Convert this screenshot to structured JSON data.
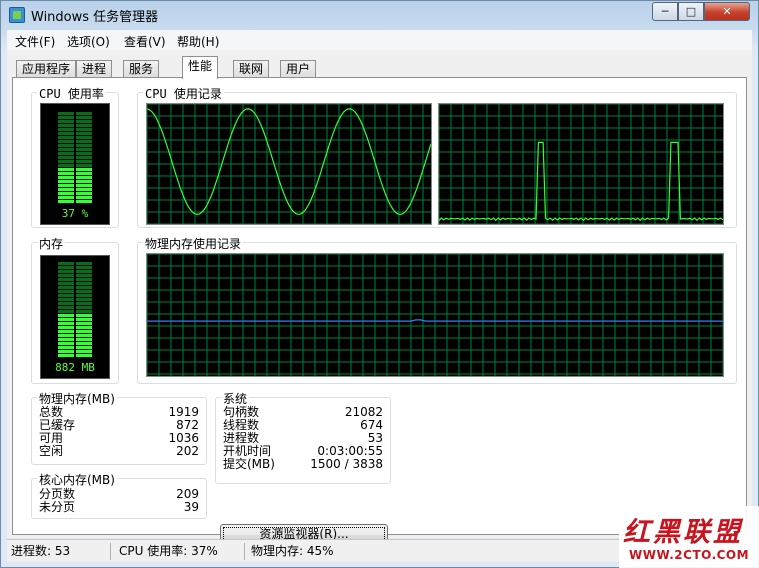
{
  "window": {
    "title": "Windows 任务管理器",
    "min_glyph": "─",
    "max_glyph": "□",
    "close_glyph": "✕"
  },
  "menu": [
    {
      "label": "文件(F)"
    },
    {
      "label": "选项(O)"
    },
    {
      "label": "查看(V)"
    },
    {
      "label": "帮助(H)"
    }
  ],
  "tabs": [
    {
      "label": "应用程序",
      "active": false
    },
    {
      "label": "进程",
      "active": false
    },
    {
      "label": "服务",
      "active": false
    },
    {
      "label": "性能",
      "active": true
    },
    {
      "label": "联网",
      "active": false
    },
    {
      "label": "用户",
      "active": false
    }
  ],
  "cpu": {
    "usage_title": "CPU 使用率",
    "usage_text": "37 %",
    "usage_level": 0.37,
    "history_title": "CPU 使用记录"
  },
  "memory": {
    "title": "内存",
    "usage_text": "882 MB",
    "usage_level": 0.45,
    "history_title": "物理内存使用记录"
  },
  "physical_memory": {
    "title": "物理内存(MB)",
    "rows": [
      {
        "label": "总数",
        "value": "1919"
      },
      {
        "label": "已缓存",
        "value": "872"
      },
      {
        "label": "可用",
        "value": "1036"
      },
      {
        "label": "空闲",
        "value": "202"
      }
    ]
  },
  "kernel_memory": {
    "title": "核心内存(MB)",
    "rows": [
      {
        "label": "分页数",
        "value": "209"
      },
      {
        "label": "未分页",
        "value": "39"
      }
    ]
  },
  "system": {
    "title": "系统",
    "rows": [
      {
        "label": "句柄数",
        "value": "21082"
      },
      {
        "label": "线程数",
        "value": "674"
      },
      {
        "label": "进程数",
        "value": "53"
      },
      {
        "label": "开机时间",
        "value": "0:03:00:55"
      },
      {
        "label": "提交(MB)",
        "value": "1500 / 3838"
      }
    ]
  },
  "resource_monitor_button": "资源监视器(R)...",
  "status": {
    "processes": "进程数: 53",
    "cpu": "CPU 使用率: 37%",
    "memory": "物理内存: 45%"
  },
  "watermark": {
    "brand": "红黑联盟",
    "url": "WWW.2CTO.COM"
  },
  "colors": {
    "graph_bg": "#000000",
    "grid": "#008040",
    "cpu_line": "#33ff33",
    "mem_line": "#3d7bff",
    "gauge_on": "#33ff33",
    "gauge_off": "#0a6b1a"
  }
}
